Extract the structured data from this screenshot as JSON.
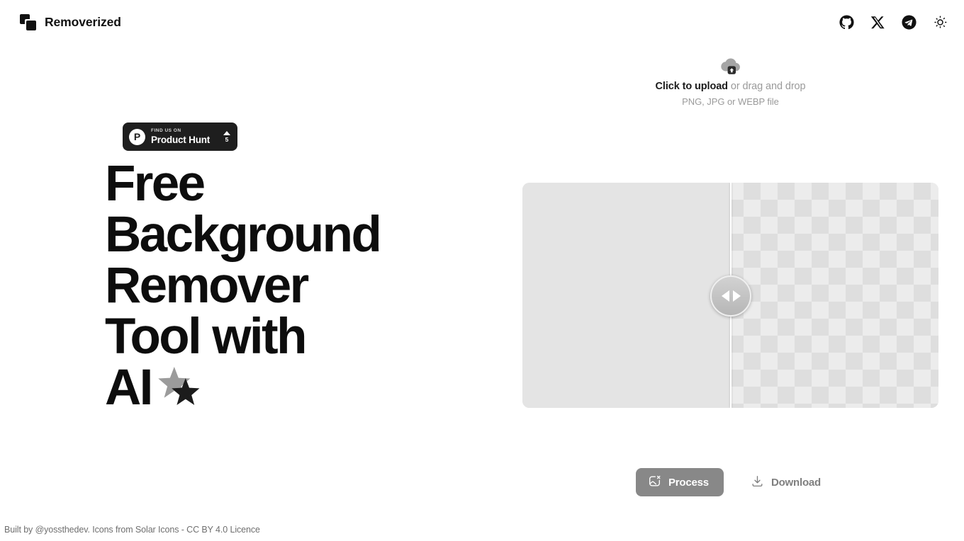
{
  "header": {
    "brand_name": "Removerized",
    "logo_icon": "overlapping-squares-logo",
    "icons": [
      {
        "name": "github-icon",
        "label": "GitHub"
      },
      {
        "name": "x-twitter-icon",
        "label": "X"
      },
      {
        "name": "telegram-icon",
        "label": "Telegram"
      },
      {
        "name": "sun-theme-icon",
        "label": "Toggle theme"
      }
    ]
  },
  "upload": {
    "icon": "cloud-upload-icon",
    "action_label": "Click to upload",
    "hint_label": " or drag and drop",
    "formats": "PNG, JPG or WEBP file"
  },
  "product_hunt": {
    "mark": "P",
    "kicker": "FIND US ON",
    "title": "Product Hunt",
    "upvote_count": "5"
  },
  "hero": {
    "line1": "Free",
    "line2": "Background",
    "line3": "Remover",
    "line4": "Tool with",
    "line5": "AI",
    "sticker_icon": "double-star-sticker"
  },
  "compare": {
    "divider_position_percent": 50,
    "handle_icon": "left-right-arrows-icon",
    "before_color": "#e4e4e4",
    "after_pattern": "transparent-checkerboard"
  },
  "actions": {
    "process_label": "Process",
    "process_icon": "image-remove-icon",
    "process_color": "#888888",
    "download_label": "Download",
    "download_icon": "download-icon"
  },
  "footer": {
    "text": "Built by @yossthedev. Icons from Solar Icons - CC BY 4.0 Licence"
  }
}
